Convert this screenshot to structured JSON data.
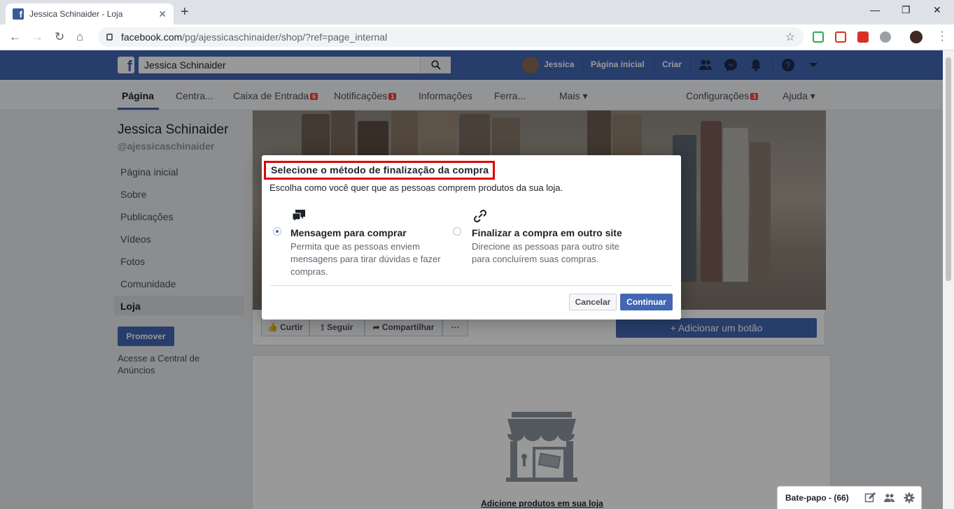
{
  "browser": {
    "tab_title": "Jessica Schinaider - Loja",
    "url_domain": "facebook.com",
    "url_path": "/pg/ajessicaschinaider/shop/?ref=page_internal"
  },
  "fb_header": {
    "search_value": "Jessica Schinaider",
    "profile_name": "Jessica",
    "home_label": "Página inicial",
    "create_label": "Criar"
  },
  "page_tabs": {
    "pagina": "Página",
    "central": "Centra...",
    "inbox": "Caixa de Entrada",
    "inbox_badge": "6",
    "notifications": "Notificações",
    "notifications_badge": "1",
    "insights": "Informações",
    "tools": "Ferra...",
    "more": "Mais ▾",
    "settings": "Configurações",
    "settings_badge": "3",
    "help": "Ajuda ▾"
  },
  "sidebar": {
    "page_name": "Jessica Schinaider",
    "handle": "@ajessicaschinaider",
    "items": [
      {
        "label": "Página inicial"
      },
      {
        "label": "Sobre"
      },
      {
        "label": "Publicações"
      },
      {
        "label": "Vídeos"
      },
      {
        "label": "Fotos"
      },
      {
        "label": "Comunidade"
      },
      {
        "label": "Loja"
      }
    ],
    "promote_label": "Promover",
    "ad_center_label": "Acesse a Central de Anúncios"
  },
  "page_actions": {
    "like": "Curtir",
    "follow": "Seguir",
    "share": "Compartilhar",
    "more": "···",
    "add_button": "+ Adicionar um botão"
  },
  "shop": {
    "add_products": "Adicione produtos em sua loja"
  },
  "modal": {
    "title": "Selecione o método de finalização da compra",
    "subtitle": "Escolha como você quer que as pessoas comprem produtos da sua loja.",
    "option1": {
      "title": "Mensagem para comprar",
      "description": "Permita que as pessoas enviem mensagens para tirar dúvidas e fazer compras.",
      "selected": true
    },
    "option2": {
      "title": "Finalizar a compra em outro site",
      "description": "Direcione as pessoas para outro site para concluírem suas compras.",
      "selected": false
    },
    "cancel_label": "Cancelar",
    "continue_label": "Continuar"
  },
  "chat": {
    "label": "Bate-papo - (66)"
  },
  "colors": {
    "fb_blue": "#4267b2",
    "highlight_red": "#e00000"
  }
}
